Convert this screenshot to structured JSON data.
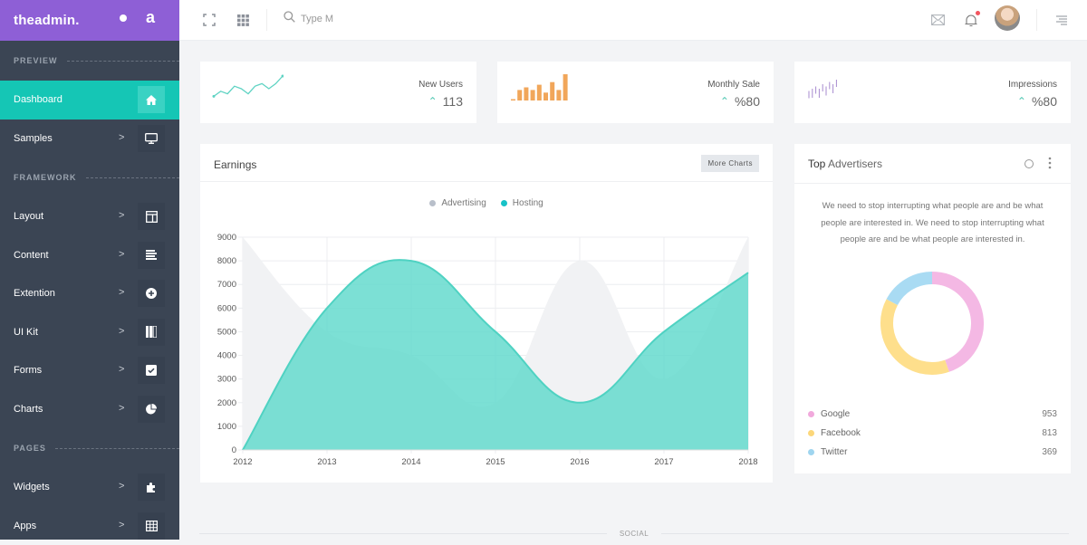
{
  "brand": {
    "logo_bold": "theadmin.",
    "short": "a"
  },
  "sidebar": {
    "sections": [
      {
        "header": "PREVIEW",
        "items": [
          {
            "label": "Dashboard",
            "icon": "home-icon",
            "active": true
          },
          {
            "label": "Samples",
            "icon": "monitor-icon"
          }
        ]
      },
      {
        "header": "FRAMEWORK",
        "items": [
          {
            "label": "Layout",
            "icon": "layout-icon"
          },
          {
            "label": "Content",
            "icon": "align-left-icon"
          },
          {
            "label": "Extention",
            "icon": "plus-circle-icon"
          },
          {
            "label": "UI Kit",
            "icon": "books-icon"
          },
          {
            "label": "Forms",
            "icon": "checkbox-icon"
          },
          {
            "label": "Charts",
            "icon": "pie-chart-icon"
          }
        ]
      },
      {
        "header": "PAGES",
        "items": [
          {
            "label": "Widgets",
            "icon": "puzzle-icon"
          },
          {
            "label": "Apps",
            "icon": "grid-icon"
          }
        ]
      }
    ],
    "chevron": ">"
  },
  "topbar": {
    "search_placeholder": "Type M",
    "icons": [
      "fullscreen-icon",
      "apps-grid-icon",
      "search-icon",
      "mail-icon",
      "bell-icon",
      "avatar",
      "menu-icon"
    ]
  },
  "stats": [
    {
      "label": "New Users",
      "value": "113",
      "trend": "up",
      "spark_type": "line",
      "color": "#5fd3c3",
      "spark": [
        2,
        4,
        3,
        6,
        5,
        3,
        6,
        7,
        5,
        7,
        10
      ]
    },
    {
      "label": "Monthly Sale",
      "value": "%80",
      "trend": "up",
      "spark_type": "bar",
      "color": "#f1a65a",
      "spark": [
        0.5,
        4,
        5,
        4,
        6,
        3,
        7,
        4,
        10
      ]
    },
    {
      "label": "Impressions",
      "value": "%80",
      "trend": "up",
      "spark_type": "candle",
      "color": "#a78bcf",
      "spark": [
        3,
        4,
        5,
        4,
        6,
        5,
        7,
        6,
        8
      ]
    }
  ],
  "earnings": {
    "title": "Earnings",
    "more_label": "More Charts",
    "chart_data": {
      "type": "area",
      "title": "Earnings",
      "x": [
        "2012",
        "2013",
        "2014",
        "2015",
        "2016",
        "2017",
        "2018"
      ],
      "ylim": [
        0,
        9000
      ],
      "yticks": [
        0,
        1000,
        2000,
        3000,
        4000,
        5000,
        6000,
        7000,
        8000,
        9000
      ],
      "grid": true,
      "legend_position": "top-center",
      "series": [
        {
          "name": "Advertising",
          "color": "#b8bfca",
          "fill": "#f1f2f4",
          "values": [
            9000,
            5000,
            4000,
            2000,
            8000,
            3000,
            9000
          ]
        },
        {
          "name": "Hosting",
          "color": "#17c2c7",
          "fill": "#5fd9cc",
          "values": [
            0,
            6000,
            8000,
            5000,
            2000,
            5000,
            7500
          ]
        }
      ]
    }
  },
  "advertisers": {
    "title_bold": "Top",
    "title_rest": " Advertisers",
    "description": "We need to stop interrupting what people are and be what people are interested in. We need to stop interrupting what people are and be what people are interested in.",
    "chart_data": {
      "type": "pie",
      "donut": true,
      "labels": [
        "Google",
        "Facebook",
        "Twitter"
      ],
      "values": [
        953,
        813,
        369
      ],
      "colors": [
        "#f4b8e4",
        "#fedf8c",
        "#a9dbf3"
      ]
    },
    "items": [
      {
        "name": "Google",
        "value": "953",
        "color": "#f1a9dc"
      },
      {
        "name": "Facebook",
        "value": "813",
        "color": "#fcd77a"
      },
      {
        "name": "Twitter",
        "value": "369",
        "color": "#9fd5ef"
      }
    ]
  },
  "footer_section": {
    "label": "SOCIAL"
  }
}
